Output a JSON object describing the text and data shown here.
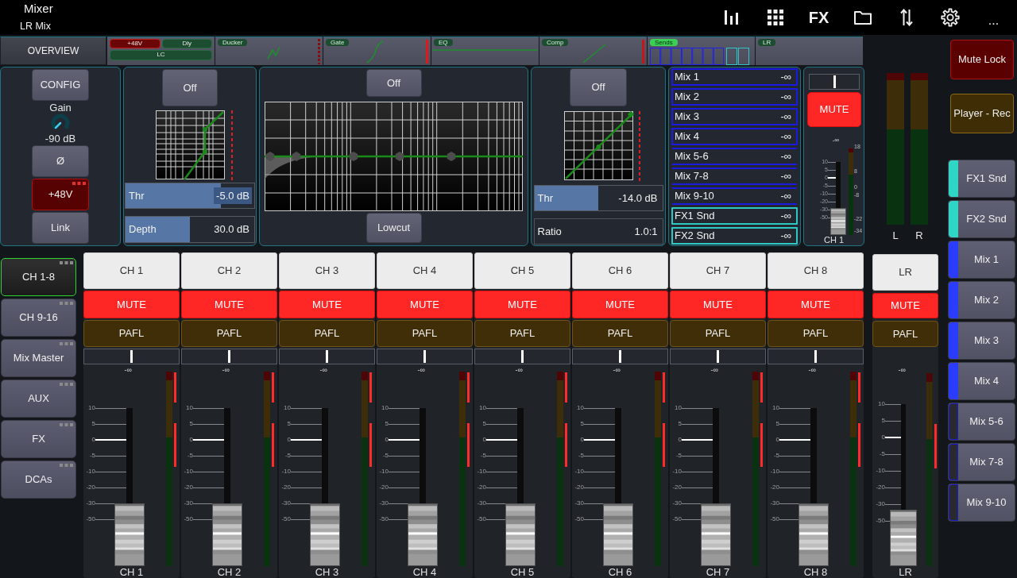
{
  "header": {
    "title": "Mixer",
    "subtitle": "LR Mix",
    "fx_label": "FX",
    "more_label": "..."
  },
  "overview": {
    "button": "OVERVIEW",
    "blocks": [
      {
        "kind": "input",
        "tags": [
          {
            "label": "+48V",
            "on": true
          },
          {
            "label": "Dly",
            "on": false
          },
          {
            "label": "LC",
            "on": false
          }
        ]
      },
      {
        "kind": "ducker",
        "label": "Ducker",
        "active": false
      },
      {
        "kind": "gate",
        "label": "Gate",
        "active": false
      },
      {
        "kind": "eq",
        "label": "EQ",
        "active": false
      },
      {
        "kind": "comp",
        "label": "Comp",
        "active": false
      },
      {
        "kind": "sends",
        "label": "Sends",
        "active": true
      },
      {
        "kind": "lr",
        "label": "LR",
        "active": false
      }
    ]
  },
  "preamp": {
    "config_button": "CONFIG",
    "gain": {
      "label": "Gain",
      "reading": "-90 dB"
    },
    "buttons": [
      {
        "label": "Ø",
        "on": false,
        "options": false
      },
      {
        "label": "+48V",
        "on": true,
        "options": true
      },
      {
        "label": "Link",
        "on": false,
        "options": false
      }
    ]
  },
  "gate": {
    "button": "Off",
    "sliders": [
      {
        "label": "Thr",
        "reading": "-5.0 dB",
        "level": 0.74
      },
      {
        "label": "Depth",
        "reading": "30.0 dB",
        "level": 0.5
      }
    ]
  },
  "eq": {
    "button": "Off",
    "lowcut_button": "Lowcut"
  },
  "comp": {
    "button": "Off",
    "threshold": {
      "label": "Thr",
      "reading": "-14.0 dB",
      "level": 0.5
    },
    "ratio": {
      "label": "Ratio",
      "value": "1.0:1"
    }
  },
  "sends": [
    {
      "name": "Mix 1",
      "reading": "-∞",
      "color": "#1a1ae0",
      "stereo": false
    },
    {
      "name": "Mix 2",
      "reading": "-∞",
      "color": "#1a1ae0",
      "stereo": false
    },
    {
      "name": "Mix 3",
      "reading": "-∞",
      "color": "#1a1ae0",
      "stereo": false
    },
    {
      "name": "Mix 4",
      "reading": "-∞",
      "color": "#1a1ae0",
      "stereo": false
    },
    {
      "name": "Mix 5-6",
      "reading": "-∞",
      "color": "#1a1ae0",
      "stereo": true
    },
    {
      "name": "Mix 7-8",
      "reading": "-∞",
      "color": "#1a1ae0",
      "stereo": true
    },
    {
      "name": "Mix 9-10",
      "reading": "-∞",
      "color": "#1a1ae0",
      "stereo": true
    },
    {
      "name": "FX1 Snd",
      "reading": "-∞",
      "color": "#2ec8c4",
      "stereo": false
    },
    {
      "name": "FX2 Snd",
      "reading": "-∞",
      "color": "#2ec8c4",
      "stereo": false
    }
  ],
  "channel": {
    "pan": {
      "level": 0.5
    },
    "mute": {
      "label": "MUTE",
      "on": true
    },
    "reading": "-∞",
    "scale": [
      "10",
      "5",
      "0",
      "-5",
      "-10",
      "-20",
      "-30",
      "-50"
    ],
    "meter_scale": [
      "18",
      "8",
      "0",
      "-8",
      "-22",
      "-34"
    ],
    "fader": {
      "level": 0
    },
    "label": "CH 1"
  },
  "main_meters": [
    {
      "label": "L"
    },
    {
      "label": "R"
    }
  ],
  "side_buttons": [
    {
      "kind": "lock",
      "label": "Mute Lock"
    },
    {
      "kind": "player",
      "label": "Player - Rec"
    }
  ],
  "layers": [
    {
      "label": "FX1 Snd",
      "color": "#2fd6c6",
      "stereo": false
    },
    {
      "label": "FX2 Snd",
      "color": "#2fd6c6",
      "stereo": false
    },
    {
      "label": "Mix 1",
      "color": "#2b3cff",
      "stereo": false
    },
    {
      "label": "Mix 2",
      "color": "#2b3cff",
      "stereo": false
    },
    {
      "label": "Mix 3",
      "color": "#2b3cff",
      "stereo": false
    },
    {
      "label": "Mix 4",
      "color": "#2b3cff",
      "stereo": false
    },
    {
      "label": "Mix 5-6",
      "color": "#1a1ad0",
      "stereo": true
    },
    {
      "label": "Mix 7-8",
      "color": "#1a1ad0",
      "stereo": true
    },
    {
      "label": "Mix 9-10",
      "color": "#1a1ad0",
      "stereo": true
    }
  ],
  "banks": [
    {
      "label": "CH 1-8",
      "selected": true
    },
    {
      "label": "CH 9-16",
      "selected": false
    },
    {
      "label": "Mix Master",
      "selected": false
    },
    {
      "label": "AUX",
      "selected": false
    },
    {
      "label": "FX",
      "selected": false
    },
    {
      "label": "DCAs",
      "selected": false
    }
  ],
  "strips": [
    {
      "name": "CH 1",
      "mute": {
        "label": "MUTE",
        "on": true
      },
      "pafl": {
        "label": "PAFL",
        "on": false
      },
      "pan": {
        "level": 0.5
      },
      "reading": "-∞",
      "scale": [
        "10",
        "5",
        "0",
        "-5",
        "-10",
        "-20",
        "-30",
        "-50"
      ],
      "fader": {
        "level": 0
      },
      "label": "CH 1"
    },
    {
      "name": "CH 2",
      "mute": {
        "label": "MUTE",
        "on": true
      },
      "pafl": {
        "label": "PAFL",
        "on": false
      },
      "pan": {
        "level": 0.5
      },
      "reading": "-∞",
      "scale": [
        "10",
        "5",
        "0",
        "-5",
        "-10",
        "-20",
        "-30",
        "-50"
      ],
      "fader": {
        "level": 0
      },
      "label": "CH 2"
    },
    {
      "name": "CH 3",
      "mute": {
        "label": "MUTE",
        "on": true
      },
      "pafl": {
        "label": "PAFL",
        "on": false
      },
      "pan": {
        "level": 0.5
      },
      "reading": "-∞",
      "scale": [
        "10",
        "5",
        "0",
        "-5",
        "-10",
        "-20",
        "-30",
        "-50"
      ],
      "fader": {
        "level": 0
      },
      "label": "CH 3"
    },
    {
      "name": "CH 4",
      "mute": {
        "label": "MUTE",
        "on": true
      },
      "pafl": {
        "label": "PAFL",
        "on": false
      },
      "pan": {
        "level": 0.5
      },
      "reading": "-∞",
      "scale": [
        "10",
        "5",
        "0",
        "-5",
        "-10",
        "-20",
        "-30",
        "-50"
      ],
      "fader": {
        "level": 0
      },
      "label": "CH 4"
    },
    {
      "name": "CH 5",
      "mute": {
        "label": "MUTE",
        "on": true
      },
      "pafl": {
        "label": "PAFL",
        "on": false
      },
      "pan": {
        "level": 0.5
      },
      "reading": "-∞",
      "scale": [
        "10",
        "5",
        "0",
        "-5",
        "-10",
        "-20",
        "-30",
        "-50"
      ],
      "fader": {
        "level": 0
      },
      "label": "CH 5"
    },
    {
      "name": "CH 6",
      "mute": {
        "label": "MUTE",
        "on": true
      },
      "pafl": {
        "label": "PAFL",
        "on": false
      },
      "pan": {
        "level": 0.5
      },
      "reading": "-∞",
      "scale": [
        "10",
        "5",
        "0",
        "-5",
        "-10",
        "-20",
        "-30",
        "-50"
      ],
      "fader": {
        "level": 0
      },
      "label": "CH 6"
    },
    {
      "name": "CH 7",
      "mute": {
        "label": "MUTE",
        "on": true
      },
      "pafl": {
        "label": "PAFL",
        "on": false
      },
      "pan": {
        "level": 0.5
      },
      "reading": "-∞",
      "scale": [
        "10",
        "5",
        "0",
        "-5",
        "-10",
        "-20",
        "-30",
        "-50"
      ],
      "fader": {
        "level": 0
      },
      "label": "CH 7"
    },
    {
      "name": "CH 8",
      "mute": {
        "label": "MUTE",
        "on": true
      },
      "pafl": {
        "label": "PAFL",
        "on": false
      },
      "pan": {
        "level": 0.5
      },
      "reading": "-∞",
      "scale": [
        "10",
        "5",
        "0",
        "-5",
        "-10",
        "-20",
        "-30",
        "-50"
      ],
      "fader": {
        "level": 0
      },
      "label": "CH 8"
    }
  ],
  "master": {
    "name": "LR",
    "mute": {
      "label": "MUTE",
      "on": true
    },
    "pafl": {
      "label": "PAFL",
      "on": false
    },
    "reading": "-∞",
    "scale": [
      "10",
      "5",
      "0",
      "-5",
      "-10",
      "-20",
      "-30",
      "-50"
    ],
    "fader": {
      "level": 0
    },
    "label": "LR"
  }
}
